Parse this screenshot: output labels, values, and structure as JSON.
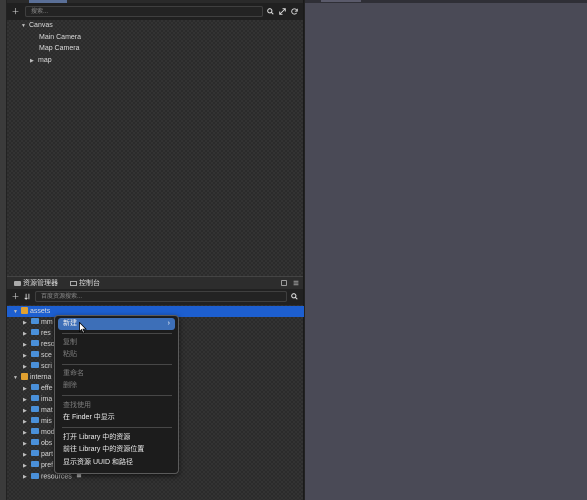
{
  "hierarchy": {
    "search": {
      "placeholder": "搜索..."
    },
    "tree": [
      {
        "label": "Canvas"
      },
      {
        "label": "Main Camera"
      },
      {
        "label": "Map Camera"
      },
      {
        "label": "map"
      }
    ]
  },
  "assets": {
    "tabs": [
      {
        "label": "资源管理器"
      },
      {
        "label": "控制台"
      }
    ],
    "search": {
      "placeholder": "百度资源搜索..."
    },
    "items": [
      {
        "label": "assets"
      },
      {
        "label": "mm"
      },
      {
        "label": "res"
      },
      {
        "label": "reso"
      },
      {
        "label": "sce"
      },
      {
        "label": "scri"
      },
      {
        "label": "interna"
      },
      {
        "label": "effe"
      },
      {
        "label": "ima"
      },
      {
        "label": "mat"
      },
      {
        "label": "mis"
      },
      {
        "label": "mod"
      },
      {
        "label": "obs"
      },
      {
        "label": "part"
      },
      {
        "label": "pref"
      },
      {
        "label": "resources"
      }
    ]
  },
  "context_menu": {
    "items": [
      {
        "label": "新建"
      },
      {
        "label": "复制"
      },
      {
        "label": "粘贴"
      },
      {
        "label": "重命名"
      },
      {
        "label": "删除"
      },
      {
        "label": "查找使用"
      },
      {
        "label": "在 Finder 中显示"
      },
      {
        "label": "打开 Library 中的资源"
      },
      {
        "label": "前往 Library 中的资源位置"
      },
      {
        "label": "显示资源 UUID 和路径"
      }
    ]
  },
  "colors": {
    "selection": "#1d5fd0",
    "menu_highlight": "#3d6fb8",
    "folder": "#4a90d9",
    "scene_bg": "#4a4a56"
  }
}
